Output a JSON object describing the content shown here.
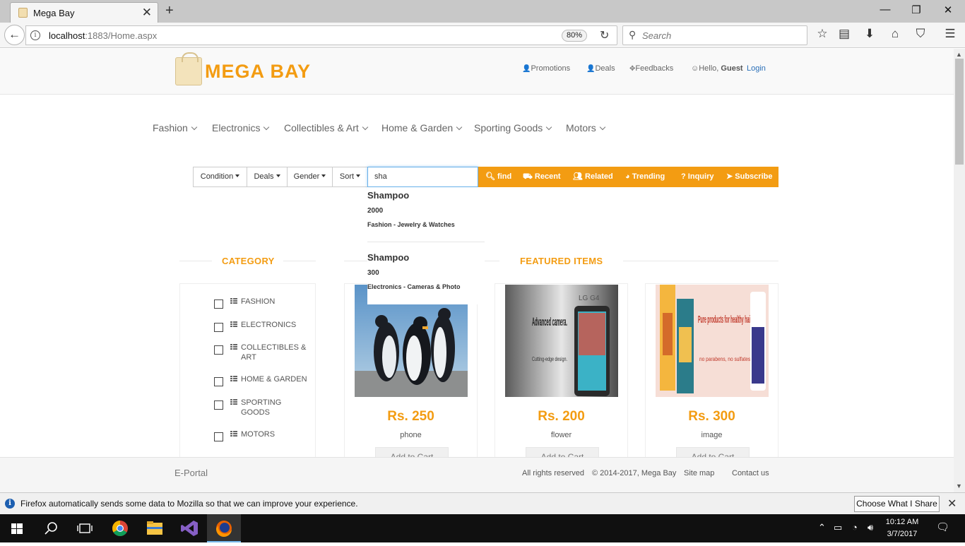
{
  "browser": {
    "tab_title": "Mega Bay",
    "url_host": "localhost",
    "url_rest": ":1883/Home.aspx",
    "zoom": "80%",
    "search_placeholder": "Search"
  },
  "header": {
    "logo": "MEGA BAY",
    "links": [
      "Promotions",
      "Deals",
      "Feedbacks"
    ],
    "greeting": "Hello,",
    "guest": "Guest",
    "login": "Login"
  },
  "menu": [
    "Fashion",
    "Electronics",
    "Collectibles & Art",
    "Home & Garden",
    "Sporting Goods",
    "Motors"
  ],
  "searchbar": {
    "dropdowns": [
      "Condition",
      "Deals",
      "Gender",
      "Sort"
    ],
    "query": "sha",
    "actions": [
      "find",
      "Recent",
      "Related",
      "Trending",
      "Inquiry",
      "Subscribe"
    ]
  },
  "autocomplete": [
    {
      "name": "Shampoo",
      "price": "2000",
      "category": "Fashion - Jewelry & Watches"
    },
    {
      "name": "Shampoo",
      "price": "300",
      "category": "Electronics - Cameras & Photo"
    }
  ],
  "sections": {
    "category": "CATEGORY",
    "featured": "FEATURED ITEMS"
  },
  "categories": [
    "FASHION",
    "ELECTRONICS",
    "COLLECTIBLES & ART",
    "HOME & GARDEN",
    "SPORTING GOODS",
    "MOTORS"
  ],
  "products": [
    {
      "price": "Rs. 250",
      "name": "phone",
      "cta": "Add to Cart"
    },
    {
      "price": "Rs. 200",
      "name": "flower",
      "cta": "Add to Cart",
      "ad_title": "Advanced camera.",
      "ad_sub": "Cutting-edge design.",
      "brand": "LG G4"
    },
    {
      "price": "Rs. 300",
      "name": "image",
      "cta": "Add to Cart",
      "ad_title": "Pure products for healthy hair",
      "ad_sub": "no parabens, no sulfates."
    }
  ],
  "footer": {
    "left": "E-Portal",
    "links": [
      "All rights reserved",
      "© 2014-2017, Mega Bay",
      "Site map",
      "Contact us"
    ]
  },
  "notification": {
    "message": "Firefox automatically sends some data to Mozilla so that we can improve your experience.",
    "button": "Choose What I Share"
  },
  "taskbar": {
    "time": "10:12 AM",
    "date": "3/7/2017"
  },
  "colors": {
    "accent": "#f39c12",
    "link": "#2a6fb8"
  }
}
